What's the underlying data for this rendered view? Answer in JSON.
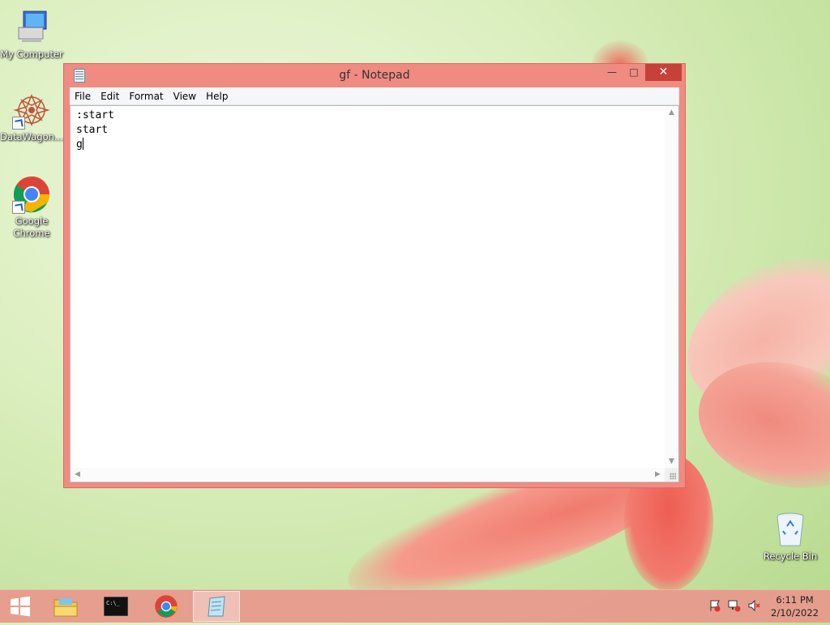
{
  "desktop": {
    "icons": [
      {
        "label": "My Computer"
      },
      {
        "label": "DataWagon..."
      },
      {
        "label": "Google Chrome"
      },
      {
        "label": "Recycle Bin"
      }
    ]
  },
  "window": {
    "title": "gf - Notepad",
    "controls": {
      "minimize": "—",
      "maximize": "□",
      "close": "✕"
    },
    "menu": [
      "File",
      "Edit",
      "Format",
      "View",
      "Help"
    ],
    "content_lines": [
      ":start",
      "start",
      "g"
    ]
  },
  "taskbar": {
    "items": [
      {
        "name": "start-button"
      },
      {
        "name": "file-explorer"
      },
      {
        "name": "command-prompt"
      },
      {
        "name": "google-chrome"
      },
      {
        "name": "notepad",
        "active": true
      }
    ],
    "clock": {
      "time": "6:11 PM",
      "date": "2/10/2022"
    }
  },
  "colors": {
    "accent": "#f08b82",
    "close_button": "#c7403a",
    "taskbar": "#e8988c"
  }
}
